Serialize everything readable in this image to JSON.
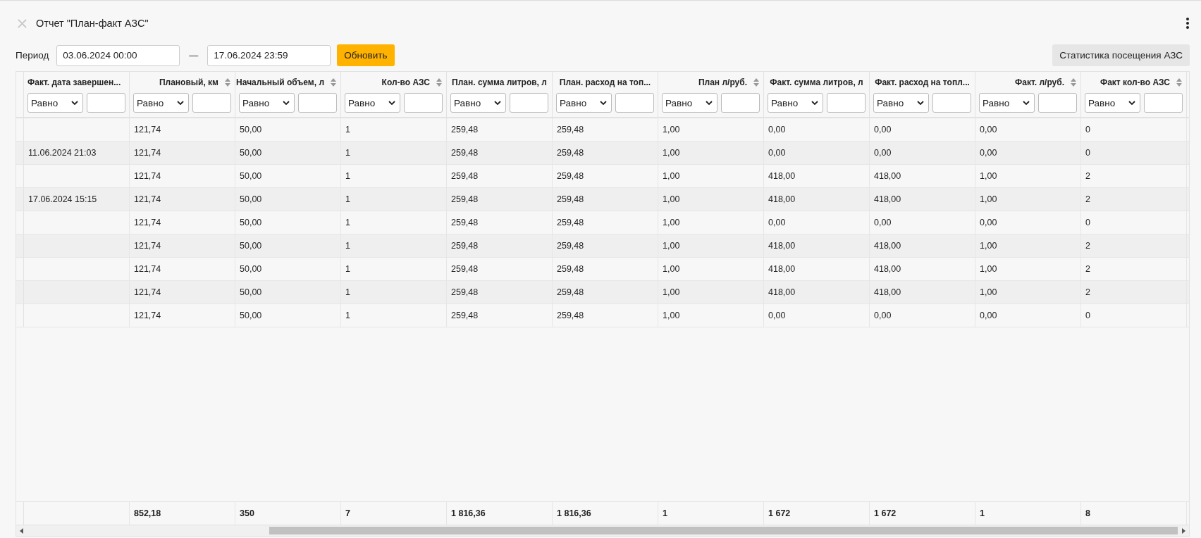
{
  "window": {
    "title": "Отчет \"План-факт АЗС\""
  },
  "period": {
    "label": "Период",
    "from": "03.06.2024 00:00",
    "separator": "—",
    "to": "17.06.2024 23:59",
    "refresh_button": "Обновить"
  },
  "stats_button": "Статистика посещения АЗС",
  "table": {
    "columns": [
      {
        "label": "Факт. дата завершен...",
        "sortable": false,
        "filter_operator": "Равно"
      },
      {
        "label": "Плановый, км",
        "sortable": true,
        "filter_operator": "Равно"
      },
      {
        "label": "Начальный объем, л",
        "sortable": true,
        "filter_operator": "Равно"
      },
      {
        "label": "Кол-во АЗС",
        "sortable": true,
        "filter_operator": "Равно"
      },
      {
        "label": "План. сумма литров, л",
        "sortable": false,
        "filter_operator": "Равно"
      },
      {
        "label": "План. расход на топ...",
        "sortable": false,
        "filter_operator": "Равно"
      },
      {
        "label": "План л/руб.",
        "sortable": true,
        "filter_operator": "Равно"
      },
      {
        "label": "Факт. сумма литров, л",
        "sortable": false,
        "filter_operator": "Равно"
      },
      {
        "label": "Факт. расход на топл...",
        "sortable": false,
        "filter_operator": "Равно"
      },
      {
        "label": "Факт. л/руб.",
        "sortable": true,
        "filter_operator": "Равно"
      },
      {
        "label": "Факт кол-во АЗС",
        "sortable": true,
        "filter_operator": "Равно"
      }
    ],
    "rows": [
      {
        "values": [
          "121,74",
          "50,00",
          "1",
          "259,48",
          "259,48",
          "1,00",
          "0,00",
          "0,00",
          "0,00",
          "0"
        ]
      },
      {
        "date": "11.06.2024 21:03",
        "values": [
          "121,74",
          "50,00",
          "1",
          "259,48",
          "259,48",
          "1,00",
          "0,00",
          "0,00",
          "0,00",
          "0"
        ]
      },
      {
        "values": [
          "121,74",
          "50,00",
          "1",
          "259,48",
          "259,48",
          "1,00",
          "418,00",
          "418,00",
          "1,00",
          "2"
        ]
      },
      {
        "date": "17.06.2024 15:15",
        "values": [
          "121,74",
          "50,00",
          "1",
          "259,48",
          "259,48",
          "1,00",
          "418,00",
          "418,00",
          "1,00",
          "2"
        ]
      },
      {
        "values": [
          "121,74",
          "50,00",
          "1",
          "259,48",
          "259,48",
          "1,00",
          "0,00",
          "0,00",
          "0,00",
          "0"
        ]
      },
      {
        "values": [
          "121,74",
          "50,00",
          "1",
          "259,48",
          "259,48",
          "1,00",
          "418,00",
          "418,00",
          "1,00",
          "2"
        ]
      },
      {
        "values": [
          "121,74",
          "50,00",
          "1",
          "259,48",
          "259,48",
          "1,00",
          "418,00",
          "418,00",
          "1,00",
          "2"
        ]
      },
      {
        "values": [
          "121,74",
          "50,00",
          "1",
          "259,48",
          "259,48",
          "1,00",
          "418,00",
          "418,00",
          "1,00",
          "2"
        ]
      },
      {
        "values": [
          "121,74",
          "50,00",
          "1",
          "259,48",
          "259,48",
          "1,00",
          "0,00",
          "0,00",
          "0,00",
          "0"
        ]
      }
    ],
    "totals": [
      "852,18",
      "350",
      "7",
      "1 816,36",
      "1 816,36",
      "1",
      "1 672",
      "1 672",
      "1",
      "8"
    ]
  }
}
